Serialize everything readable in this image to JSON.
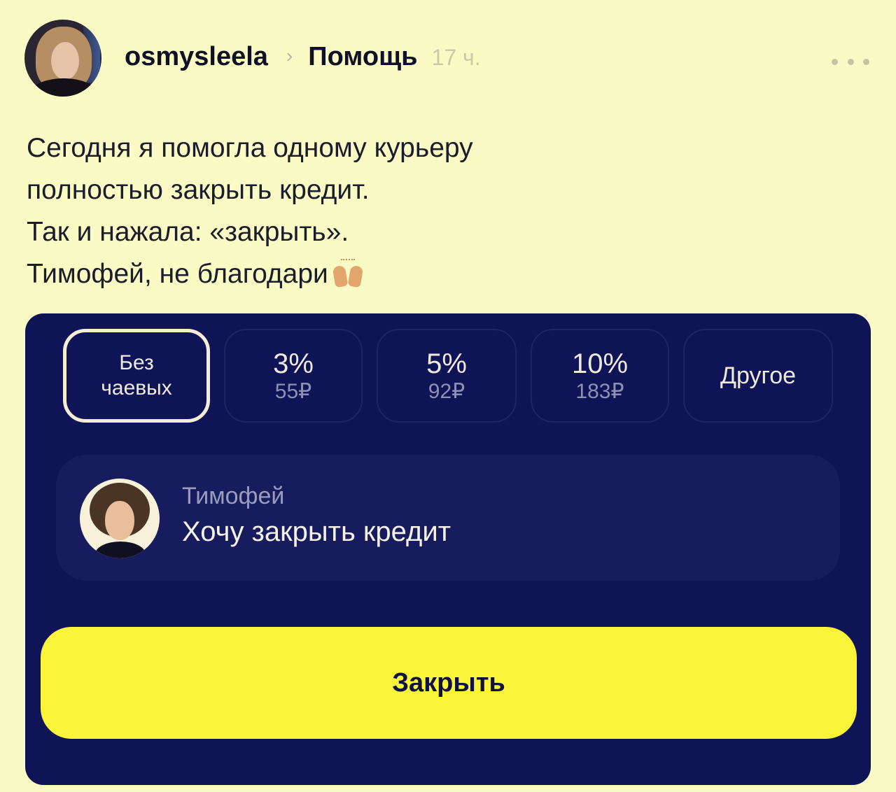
{
  "post": {
    "username": "osmysleela",
    "community": "Помощь",
    "time": "17 ч.",
    "lines": [
      "Сегодня я помогла одному курьеру",
      "полностью закрыть кредит.",
      "Так и нажала: «закрыть».",
      "Тимофей, не благодари"
    ],
    "emoji": "raising-hands-icon"
  },
  "app": {
    "tips": [
      {
        "label_line1": "Без",
        "label_line2": "чаевых",
        "selected": true
      },
      {
        "percent": "3%",
        "amount": "55₽"
      },
      {
        "percent": "5%",
        "amount": "92₽"
      },
      {
        "percent": "10%",
        "amount": "183₽"
      },
      {
        "label": "Другое"
      }
    ],
    "courier": {
      "name": "Тимофей",
      "message": "Хочу закрыть кредит"
    },
    "close_button": "Закрыть"
  },
  "colors": {
    "page_bg": "#fafbc4",
    "card_bg": "#0f1456",
    "button_bg": "#fbf53a"
  }
}
